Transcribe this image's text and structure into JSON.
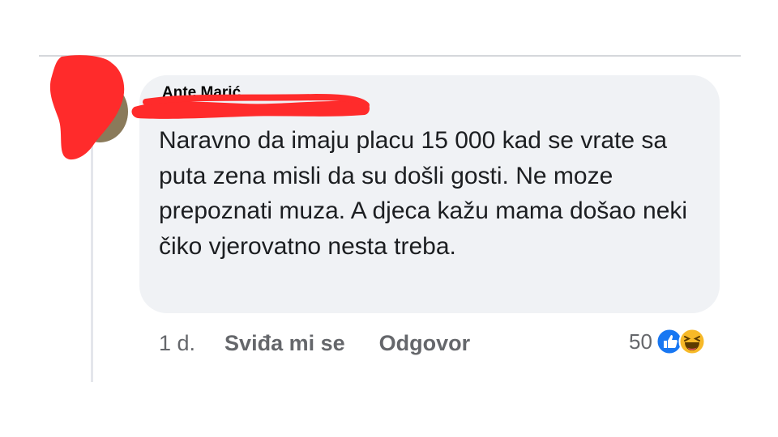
{
  "comment": {
    "author": "Ante Marić",
    "text": "Naravno da imaju placu 15 000 kad se vrate sa puta zena misli da su došli gosti. Ne moze prepoznati muza. A djeca kažu mama došao neki čiko vjerovatno nesta treba.",
    "time": "1 d.",
    "like_label": "Sviđa mi se",
    "reply_label": "Odgovor",
    "reaction_count": "50",
    "reactions": [
      "like-icon",
      "haha-icon"
    ]
  },
  "colors": {
    "bubble": "#f0f2f5",
    "redaction": "#ff2b2b",
    "like_blue": "#1877f2",
    "haha_yellow": "#f7b928"
  }
}
